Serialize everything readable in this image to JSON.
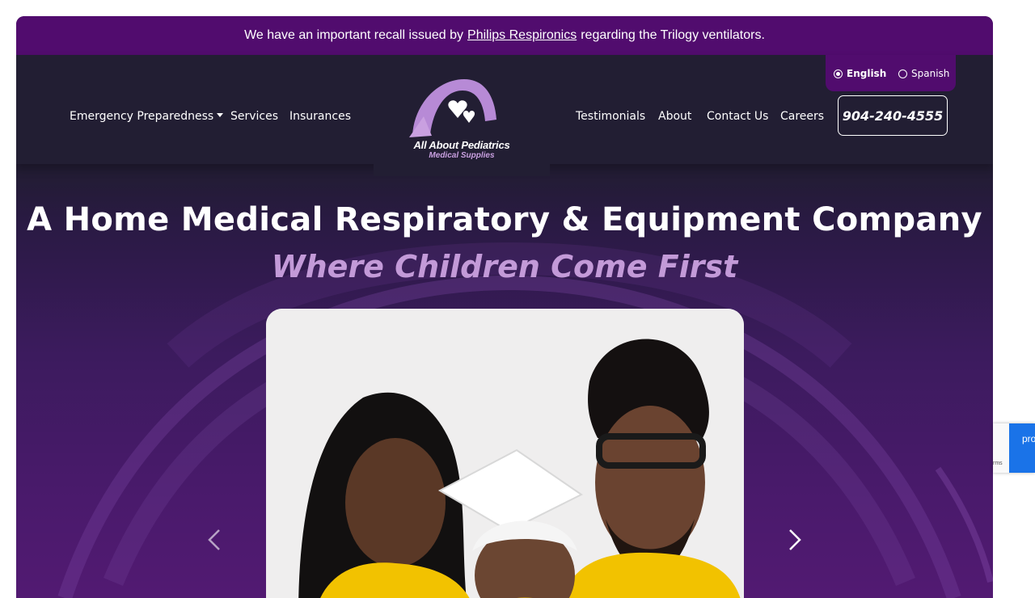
{
  "announcement": {
    "prefix": "We have an important recall issued by",
    "link": "Philips Respironics",
    "suffix": "regarding the Trilogy ventilators."
  },
  "nav": {
    "left": [
      "Emergency Preparedness",
      "Services",
      "Insurances"
    ],
    "right": [
      "Testimonials",
      "About",
      "Contact Us",
      "Careers"
    ],
    "phone": "904-240-4555"
  },
  "language": {
    "options": [
      "English",
      "Spanish"
    ],
    "selected": "English"
  },
  "logo": {
    "name": "All About Pediatrics",
    "subtitle": "Medical Supplies"
  },
  "hero": {
    "title": "A Home Medical Respiratory & Equipment Company",
    "tagline": "Where Children Come First"
  },
  "carousel": {
    "prev_icon": "chevron-left-icon",
    "next_icon": "chevron-right-icon"
  },
  "recaptcha": {
    "label": "pro",
    "terms": "rms"
  },
  "colors": {
    "brand_purple": "#510c6e",
    "nav_bg": "#221e33",
    "tagline": "#c39ad8",
    "recaptcha_blue": "#1a73e8"
  }
}
